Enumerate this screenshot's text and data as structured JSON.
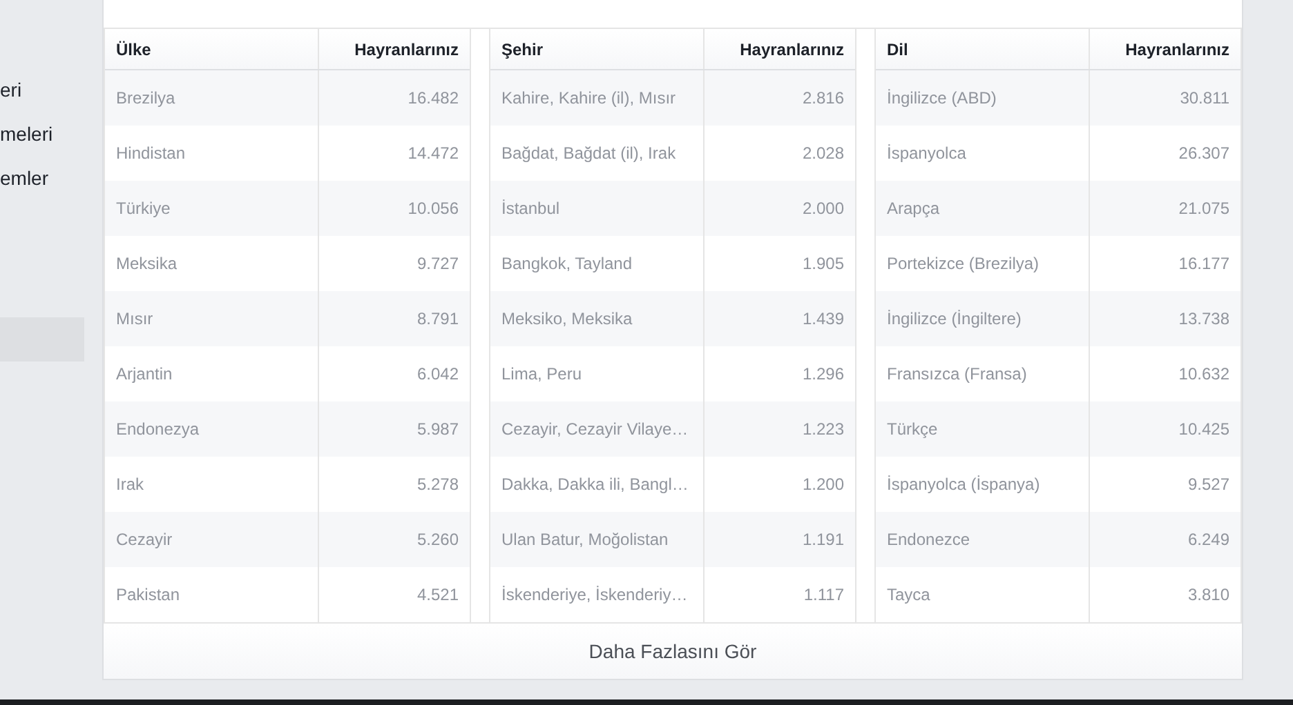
{
  "sidebar": {
    "items": [
      {
        "label": "eri",
        "selected": false
      },
      {
        "label": "meleri",
        "selected": false
      },
      {
        "label": "emler",
        "selected": false
      },
      {
        "selected": true
      }
    ]
  },
  "tables": [
    {
      "columns": [
        "Ülke",
        "Hayranlarınız"
      ],
      "rows": [
        [
          "Brezilya",
          "16.482"
        ],
        [
          "Hindistan",
          "14.472"
        ],
        [
          "Türkiye",
          "10.056"
        ],
        [
          "Meksika",
          "9.727"
        ],
        [
          "Mısır",
          "8.791"
        ],
        [
          "Arjantin",
          "6.042"
        ],
        [
          "Endonezya",
          "5.987"
        ],
        [
          "Irak",
          "5.278"
        ],
        [
          "Cezayir",
          "5.260"
        ],
        [
          "Pakistan",
          "4.521"
        ]
      ]
    },
    {
      "columns": [
        "Şehir",
        "Hayranlarınız"
      ],
      "rows": [
        [
          "Kahire, Kahire (il), Mısır",
          "2.816"
        ],
        [
          "Bağdat, Bağdat (il), Irak",
          "2.028"
        ],
        [
          "İstanbul",
          "2.000"
        ],
        [
          "Bangkok, Tayland",
          "1.905"
        ],
        [
          "Meksiko, Meksika",
          "1.439"
        ],
        [
          "Lima, Peru",
          "1.296"
        ],
        [
          "Cezayir, Cezayir Vilaye…",
          "1.223"
        ],
        [
          "Dakka, Dakka ili, Bangl…",
          "1.200"
        ],
        [
          "Ulan Batur, Moğolistan",
          "1.191"
        ],
        [
          "İskenderiye, İskenderiy…",
          "1.117"
        ]
      ]
    },
    {
      "columns": [
        "Dil",
        "Hayranlarınız"
      ],
      "rows": [
        [
          "İngilizce (ABD)",
          "30.811"
        ],
        [
          "İspanyolca",
          "26.307"
        ],
        [
          "Arapça",
          "21.075"
        ],
        [
          "Portekizce (Brezilya)",
          "16.177"
        ],
        [
          "İngilizce (İngiltere)",
          "13.738"
        ],
        [
          "Fransızca (Fransa)",
          "10.632"
        ],
        [
          "Türkçe",
          "10.425"
        ],
        [
          "İspanyolca (İspanya)",
          "9.527"
        ],
        [
          "Endonezce",
          "6.249"
        ],
        [
          "Tayca",
          "3.810"
        ]
      ]
    }
  ],
  "more_button": "Daha Fazlasını Gör"
}
